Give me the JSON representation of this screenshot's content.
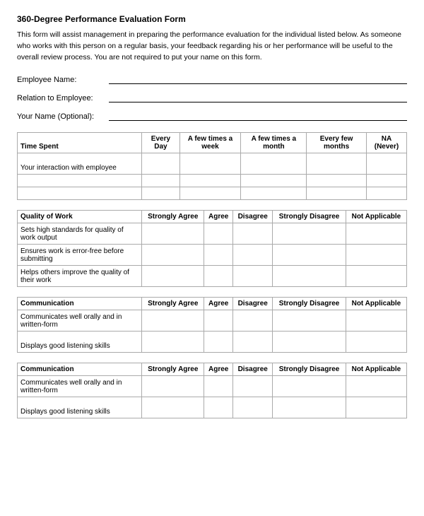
{
  "title": "360-Degree Performance Evaluation Form",
  "intro": "This form will assist management in preparing the performance evaluation for the individual listed below. As someone who works with this person on a regular basis, your feedback regarding his or her performance will be useful to the overall review process. You are not required to put your name on this form.",
  "fields": {
    "employee_name_label": "Employee Name:",
    "relation_label": "Relation to Employee:",
    "your_name_label": "Your Name (Optional):"
  },
  "table1": {
    "section_label": "Time Spent",
    "columns": [
      "Every Day",
      "A few times a week",
      "A few times a month",
      "Every few months",
      "NA (Never)"
    ],
    "rows": [
      "Your interaction with employee",
      "",
      ""
    ]
  },
  "table2": {
    "section_label": "Quality of Work",
    "columns": [
      "Strongly Agree",
      "Agree",
      "Disagree",
      "Strongly Disagree",
      "Not Applicable"
    ],
    "rows": [
      "Sets high standards for quality of work output",
      "Ensures work is error-free before submitting",
      "Helps others improve the quality of their work"
    ]
  },
  "table3": {
    "section_label": "Communication",
    "columns": [
      "Strongly Agree",
      "Agree",
      "Disagree",
      "Strongly Disagree",
      "Not Applicable"
    ],
    "rows": [
      "Communicates well orally and in written-form",
      "Displays good listening skills"
    ]
  },
  "table4": {
    "section_label": "Communication",
    "columns": [
      "Strongly Agree",
      "Agree",
      "Disagree",
      "Strongly Disagree",
      "Not Applicable"
    ],
    "rows": [
      "Communicates well orally and in written-form",
      "Displays good listening skills"
    ]
  }
}
